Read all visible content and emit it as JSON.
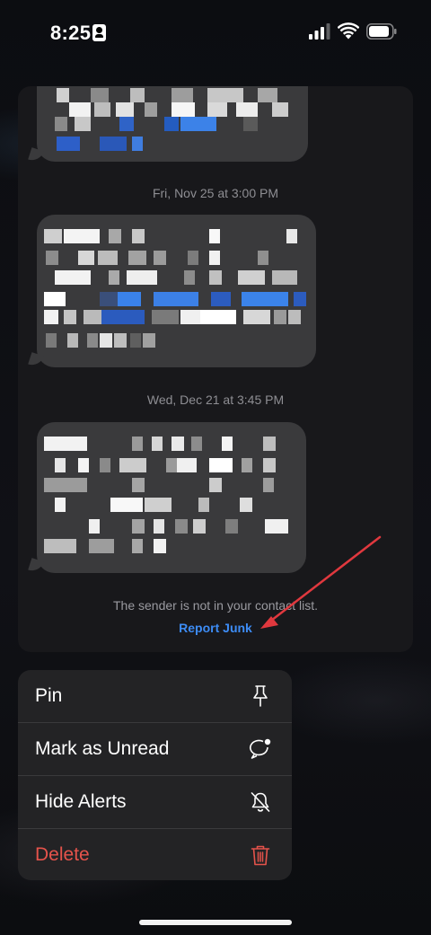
{
  "status_bar": {
    "time": "8:25",
    "icons": [
      "contact-card-icon",
      "signal-icon",
      "wifi-icon",
      "battery-icon"
    ]
  },
  "conversation": {
    "timestamps": [
      "Fri, Nov 25 at 3:00 PM",
      "Wed, Dec 21 at 3:45 PM"
    ],
    "message_bubbles": [
      "[pixelated message]",
      "[pixelated message]",
      "[pixelated message]"
    ],
    "sender_note": "The sender is not in your contact list.",
    "report_junk_label": "Report Junk"
  },
  "context_menu": {
    "items": [
      {
        "label": "Pin",
        "icon": "pin-icon"
      },
      {
        "label": "Mark as Unread",
        "icon": "unread-bubble-icon"
      },
      {
        "label": "Hide Alerts",
        "icon": "bell-slash-icon"
      },
      {
        "label": "Delete",
        "icon": "trash-icon"
      }
    ]
  },
  "colors": {
    "background": "#0b0c10",
    "card": "#18181b",
    "bubble": "#3a3a3c",
    "link_blue": "#3d8cf5",
    "destructive_red": "#e5534b",
    "annotation_arrow": "#e0383e"
  }
}
